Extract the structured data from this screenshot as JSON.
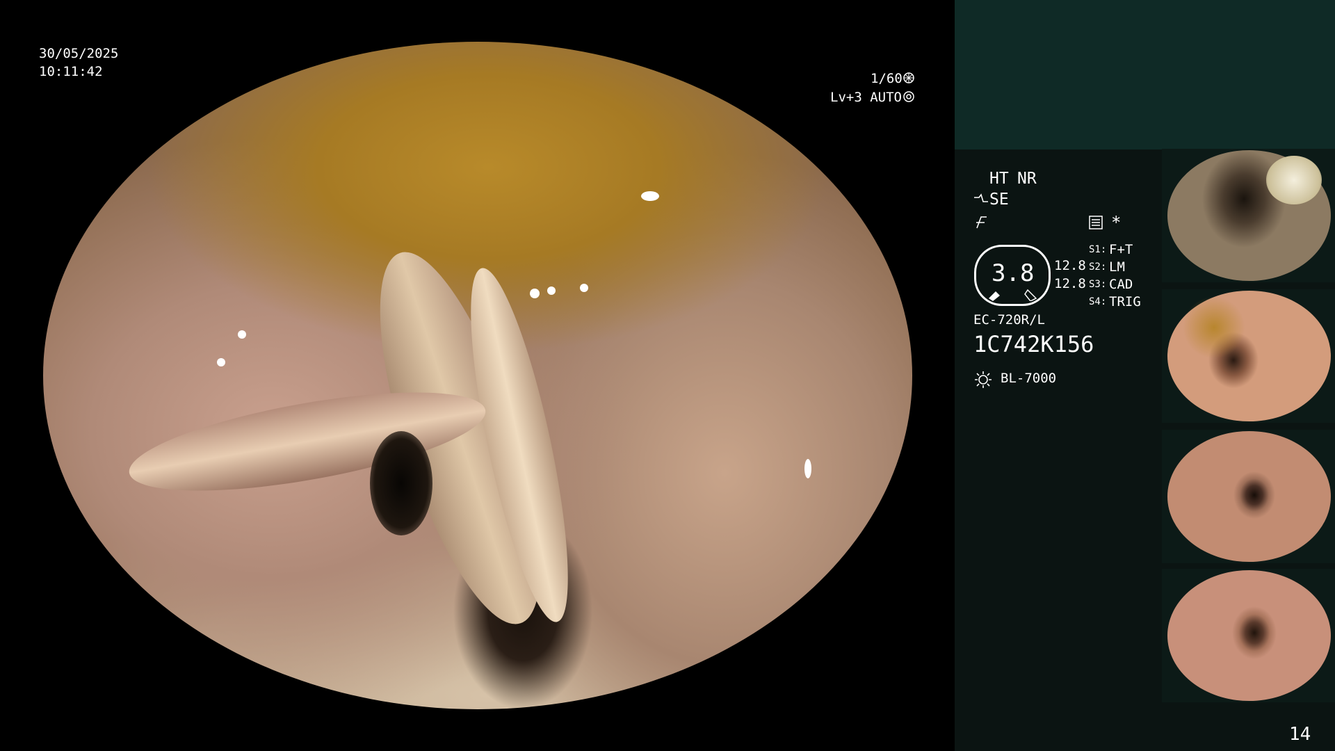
{
  "overlay": {
    "date": "30/05/2025",
    "time": "10:11:42",
    "shutter": "1/60",
    "level": "Lv+3 AUTO"
  },
  "panel": {
    "ht": "HT",
    "nr": "NR",
    "se": "SE",
    "value_main": "3.8",
    "value_a": "12.8",
    "value_b": "12.8",
    "s1_key": "S1:",
    "s1_val": "F+T",
    "s2_key": "S2:",
    "s2_val": "LM",
    "s3_key": "S3:",
    "s3_val": "CAD",
    "s4_key": "S4:",
    "s4_val": "TRIG",
    "asterisk": "*",
    "scope_model": "EC-720R/L",
    "serial": "1C742K156",
    "light_source": "BL-7000",
    "page_number": "14"
  },
  "icons": [
    "aperture-icon",
    "auto-iris-icon",
    "structure-enhance-icon",
    "color-mode-icon",
    "report-icon",
    "light-source-icon"
  ],
  "colors": {
    "accent_yellow": "#f0c030",
    "panel_bg": "#0b1412",
    "panel_top": "#0f2a26"
  }
}
